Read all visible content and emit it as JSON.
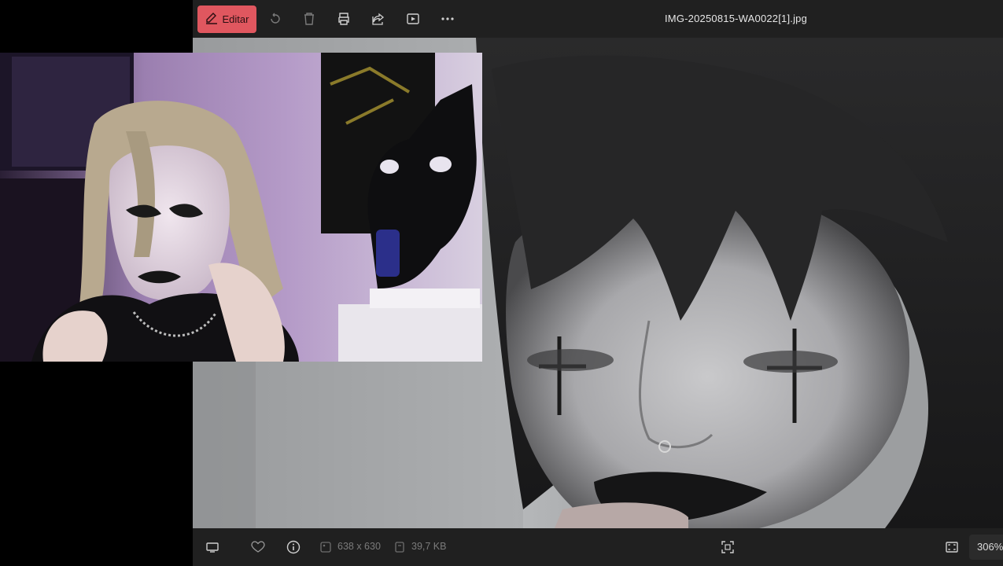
{
  "toolbar": {
    "edit_label": "Editar",
    "file_title": "IMG-20250815-WA0022[1].jpg",
    "icons": [
      "edit-icon",
      "rotate-icon",
      "delete-icon",
      "print-icon",
      "share-icon",
      "slideshow-icon",
      "more-icon"
    ]
  },
  "statusbar": {
    "dimensions": "638 x 630",
    "file_size": "39,7 KB",
    "zoom": "306%",
    "icons": [
      "display-icon",
      "favorite-icon",
      "info-icon",
      "image-dimensions-icon",
      "file-size-icon",
      "fit-to-window-icon",
      "full-screen-icon"
    ]
  },
  "colors": {
    "accent": "#e0575f",
    "toolbar_bg": "#202020",
    "status_text": "#7b7b7b"
  }
}
